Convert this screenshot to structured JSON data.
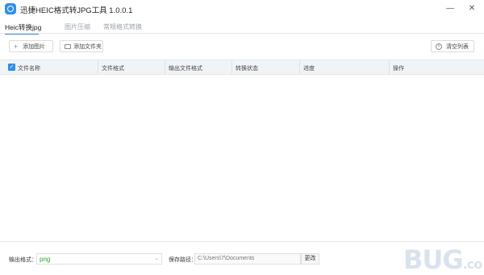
{
  "window": {
    "title": "迅捷HEIC格式转JPG工具 1.0.0.1",
    "minimize_glyph": "—",
    "close_glyph": "✕"
  },
  "tabs": [
    {
      "label": "Heic转换jpg",
      "active": true
    },
    {
      "label": "图片压缩",
      "active": false
    },
    {
      "label": "常规格式转换",
      "active": false
    }
  ],
  "toolbar": {
    "add_image": "添加图片",
    "add_folder": "添加文件夹",
    "clear_list": "清空列表"
  },
  "table": {
    "headers": [
      "文件名称",
      "文件格式",
      "输出文件格式",
      "转换状态",
      "进度",
      "操作"
    ],
    "rows": []
  },
  "footer": {
    "output_format_label": "输出格式：",
    "output_format_value": "png",
    "save_path_label": "保存路径：",
    "save_path_value": "C:\\Users\\7\\Documents",
    "browse_label": "更改"
  },
  "watermark": {
    "main": "BUG",
    "suffix": ".co"
  },
  "icons": {
    "app_logo": "app-logo-icon",
    "add": "plus-icon",
    "folder": "folder-icon",
    "clear": "circle-x-icon",
    "checkbox": "check-icon",
    "dropdown": "chevron-down-icon"
  },
  "colors": {
    "accent": "#2f8fe8",
    "format_value": "#2aa52a",
    "header_bg": "#f1f4f7"
  }
}
